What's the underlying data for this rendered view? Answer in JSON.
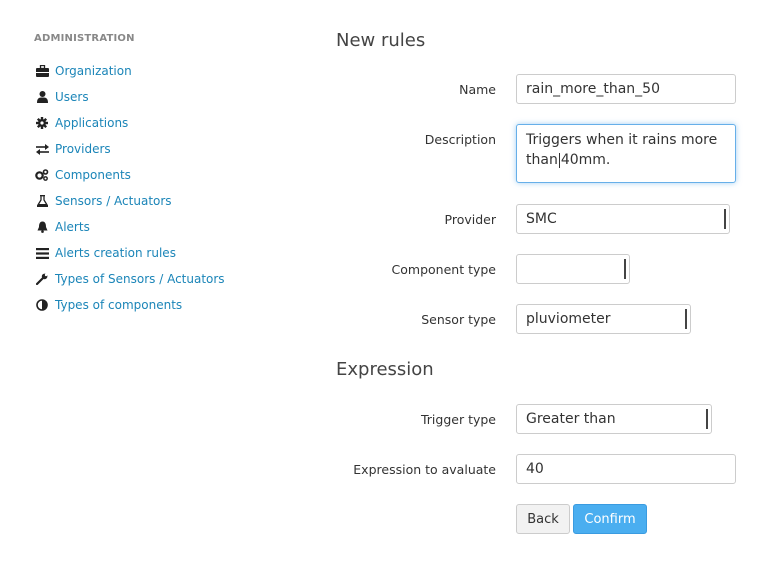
{
  "sidebar": {
    "heading": "ADMINISTRATION",
    "items": [
      {
        "label": "Organization",
        "icon": "briefcase-icon"
      },
      {
        "label": "Users",
        "icon": "user-icon"
      },
      {
        "label": "Applications",
        "icon": "gear-icon"
      },
      {
        "label": "Providers",
        "icon": "exchange-arrows-icon"
      },
      {
        "label": "Components",
        "icon": "gears-icon"
      },
      {
        "label": "Sensors / Actuators",
        "icon": "flask-icon"
      },
      {
        "label": "Alerts",
        "icon": "bell-icon"
      },
      {
        "label": "Alerts creation rules",
        "icon": "list-icon"
      },
      {
        "label": "Types of Sensors / Actuators",
        "icon": "wrench-icon"
      },
      {
        "label": "Types of components",
        "icon": "half-circle-icon"
      }
    ]
  },
  "form": {
    "section_title": "New rules",
    "name_label": "Name",
    "name_value": "rain_more_than_50",
    "description_label": "Description",
    "description_line1": "Triggers when it rains more",
    "description_line2_a": "than",
    "description_line2_b": "40mm.",
    "provider_label": "Provider",
    "provider_value": "SMC",
    "component_type_label": "Component type",
    "component_type_value": "",
    "sensor_type_label": "Sensor type",
    "sensor_type_value": "pluviometer"
  },
  "expression": {
    "section_title": "Expression",
    "trigger_type_label": "Trigger type",
    "trigger_type_value": "Greater than",
    "expression_label": "Expression to avaluate",
    "expression_value": "40"
  },
  "buttons": {
    "back_label": "Back",
    "confirm_label": "Confirm"
  },
  "colors": {
    "link": "#1b85b8",
    "primary_button": "#4aaef0",
    "focus_border": "#66afe9"
  }
}
